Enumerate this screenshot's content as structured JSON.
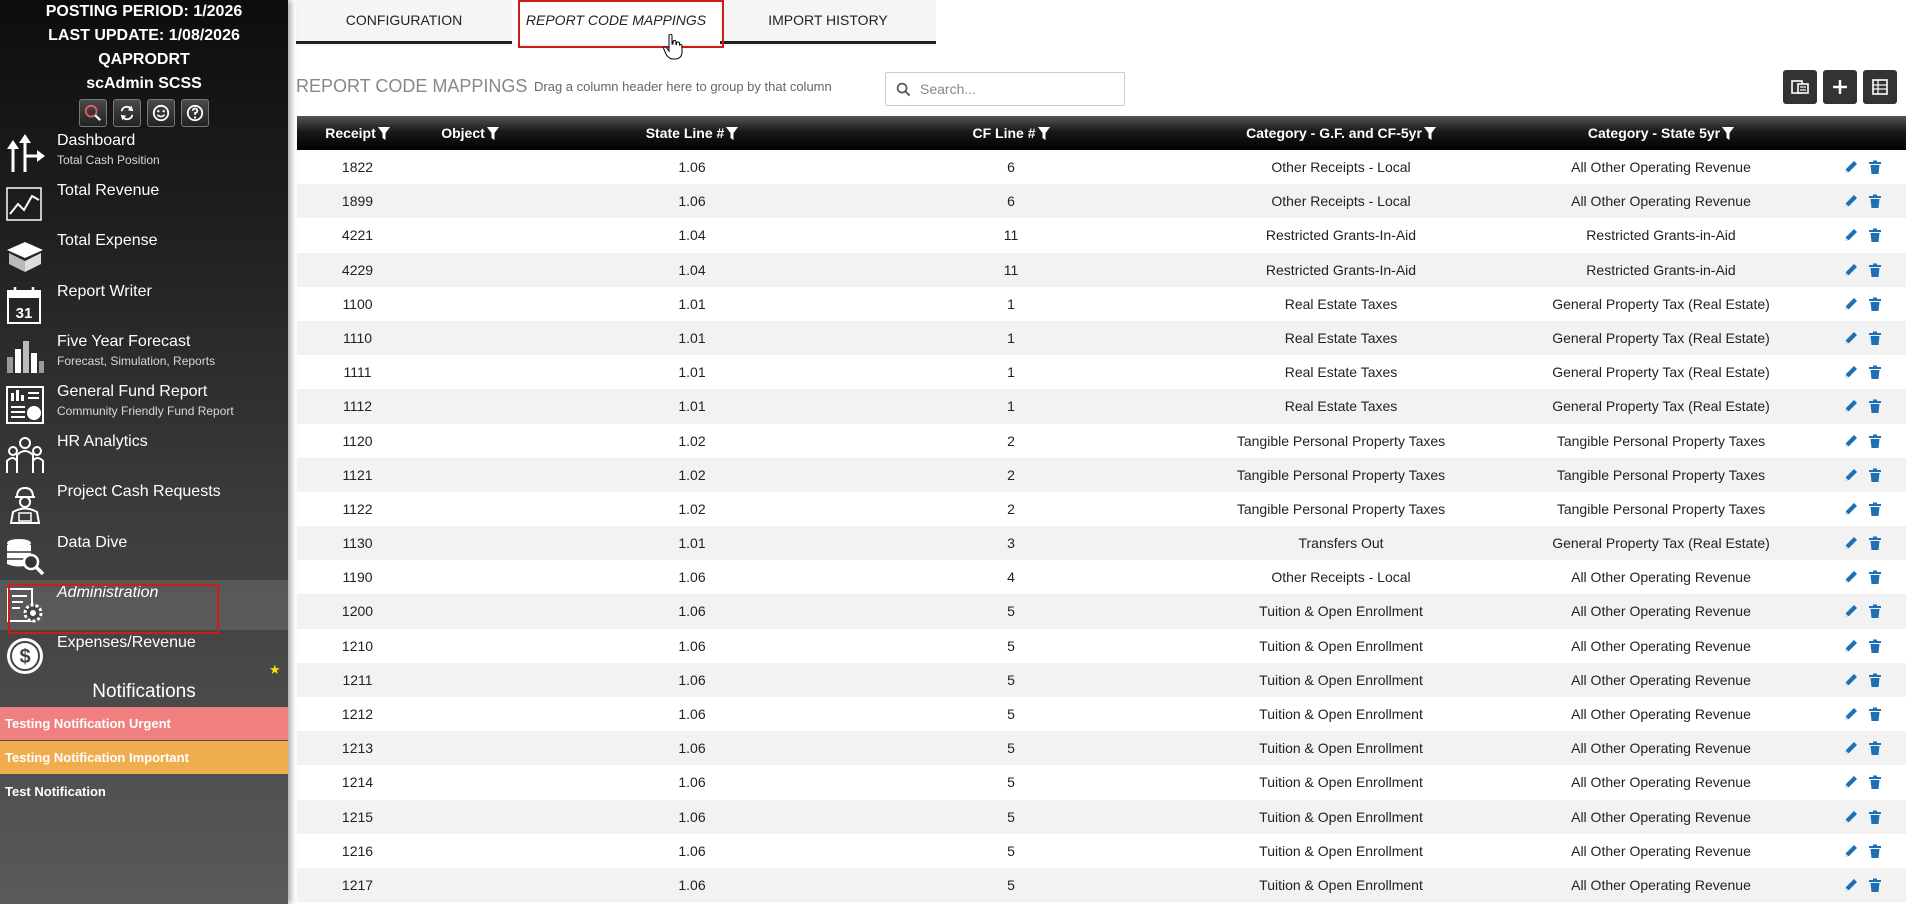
{
  "sidebar": {
    "info": {
      "posting_period": "POSTING PERIOD: 1/2026",
      "last_update": "LAST UPDATE: 1/08/2026",
      "db": "QAPRODRT",
      "user": "scAdmin SCSS"
    },
    "quick_icons": [
      "search-icon",
      "refresh-icon",
      "smiley-icon",
      "help-icon"
    ],
    "nav": [
      {
        "label": "Dashboard",
        "sub": "Total Cash Position",
        "icon": "dashboard-arrows-icon"
      },
      {
        "label": "Total Revenue",
        "sub": "",
        "icon": "revenue-chart-icon"
      },
      {
        "label": "Total Expense",
        "sub": "",
        "icon": "expense-box-icon"
      },
      {
        "label": "Report Writer",
        "sub": "",
        "icon": "calendar-icon",
        "calendar_day": "31"
      },
      {
        "label": "Five Year Forecast",
        "sub": "Forecast, Simulation, Reports",
        "icon": "bar-chart-icon"
      },
      {
        "label": "General Fund Report",
        "sub": "Community Friendly Fund Report",
        "icon": "report-icon"
      },
      {
        "label": "HR Analytics",
        "sub": "",
        "icon": "people-icon"
      },
      {
        "label": "Project Cash Requests",
        "sub": "",
        "icon": "worker-icon"
      },
      {
        "label": "Data Dive",
        "sub": "",
        "icon": "database-search-icon"
      },
      {
        "label": "Administration",
        "sub": "",
        "icon": "admin-gear-icon",
        "active": true
      },
      {
        "label": "Expenses/Revenue",
        "sub": "",
        "icon": "dollar-icon",
        "favorite": true
      }
    ],
    "notifications_title": "Notifications",
    "notifications": [
      {
        "text": "Testing Notification Urgent",
        "level": "urgent",
        "color": "#f08080"
      },
      {
        "text": "Testing Notification Important",
        "level": "important",
        "color": "#f0ad4e"
      },
      {
        "text": "Test Notification",
        "level": "normal",
        "color": ""
      }
    ]
  },
  "tabs": {
    "configuration": "CONFIGURATION",
    "report_code_mappings": "REPORT CODE MAPPINGS",
    "import_history": "IMPORT HISTORY",
    "active": "report_code_mappings"
  },
  "toolbar": {
    "title": "REPORT CODE MAPPINGS",
    "group_hint": "Drag a column header here to group by that column",
    "search_placeholder": "Search...",
    "search_value": "",
    "buttons": [
      "column-chooser-icon",
      "add-icon",
      "export-icon"
    ]
  },
  "grid": {
    "columns": [
      "Receipt",
      "Object",
      "State Line #",
      "CF Line #",
      "Category - G.F. and CF-5yr",
      "Category - State 5yr"
    ],
    "rows": [
      [
        "1822",
        "",
        "1.06",
        "6",
        "Other Receipts - Local",
        "All Other Operating Revenue"
      ],
      [
        "1899",
        "",
        "1.06",
        "6",
        "Other Receipts - Local",
        "All Other Operating Revenue"
      ],
      [
        "4221",
        "",
        "1.04",
        "11",
        "Restricted Grants-In-Aid",
        "Restricted Grants-in-Aid"
      ],
      [
        "4229",
        "",
        "1.04",
        "11",
        "Restricted Grants-In-Aid",
        "Restricted Grants-in-Aid"
      ],
      [
        "1100",
        "",
        "1.01",
        "1",
        "Real Estate Taxes",
        "General Property Tax (Real Estate)"
      ],
      [
        "1110",
        "",
        "1.01",
        "1",
        "Real Estate Taxes",
        "General Property Tax (Real Estate)"
      ],
      [
        "1111",
        "",
        "1.01",
        "1",
        "Real Estate Taxes",
        "General Property Tax (Real Estate)"
      ],
      [
        "1112",
        "",
        "1.01",
        "1",
        "Real Estate Taxes",
        "General Property Tax (Real Estate)"
      ],
      [
        "1120",
        "",
        "1.02",
        "2",
        "Tangible Personal Property Taxes",
        "Tangible Personal Property Taxes"
      ],
      [
        "1121",
        "",
        "1.02",
        "2",
        "Tangible Personal Property Taxes",
        "Tangible Personal Property Taxes"
      ],
      [
        "1122",
        "",
        "1.02",
        "2",
        "Tangible Personal Property Taxes",
        "Tangible Personal Property Taxes"
      ],
      [
        "1130",
        "",
        "1.01",
        "3",
        "Transfers Out",
        "General Property Tax (Real Estate)"
      ],
      [
        "1190",
        "",
        "1.06",
        "4",
        "Other Receipts - Local",
        "All Other Operating Revenue"
      ],
      [
        "1200",
        "",
        "1.06",
        "5",
        "Tuition & Open Enrollment",
        "All Other Operating Revenue"
      ],
      [
        "1210",
        "",
        "1.06",
        "5",
        "Tuition & Open Enrollment",
        "All Other Operating Revenue"
      ],
      [
        "1211",
        "",
        "1.06",
        "5",
        "Tuition & Open Enrollment",
        "All Other Operating Revenue"
      ],
      [
        "1212",
        "",
        "1.06",
        "5",
        "Tuition & Open Enrollment",
        "All Other Operating Revenue"
      ],
      [
        "1213",
        "",
        "1.06",
        "5",
        "Tuition & Open Enrollment",
        "All Other Operating Revenue"
      ],
      [
        "1214",
        "",
        "1.06",
        "5",
        "Tuition & Open Enrollment",
        "All Other Operating Revenue"
      ],
      [
        "1215",
        "",
        "1.06",
        "5",
        "Tuition & Open Enrollment",
        "All Other Operating Revenue"
      ],
      [
        "1216",
        "",
        "1.06",
        "5",
        "Tuition & Open Enrollment",
        "All Other Operating Revenue"
      ],
      [
        "1217",
        "",
        "1.06",
        "5",
        "Tuition & Open Enrollment",
        "All Other Operating Revenue"
      ]
    ],
    "row_actions": [
      "edit-icon",
      "delete-icon"
    ]
  },
  "colors": {
    "accent_icon": "#1f6fb5",
    "highlight_outline": "#d01b1b",
    "favorite_star": "#ffe000"
  }
}
